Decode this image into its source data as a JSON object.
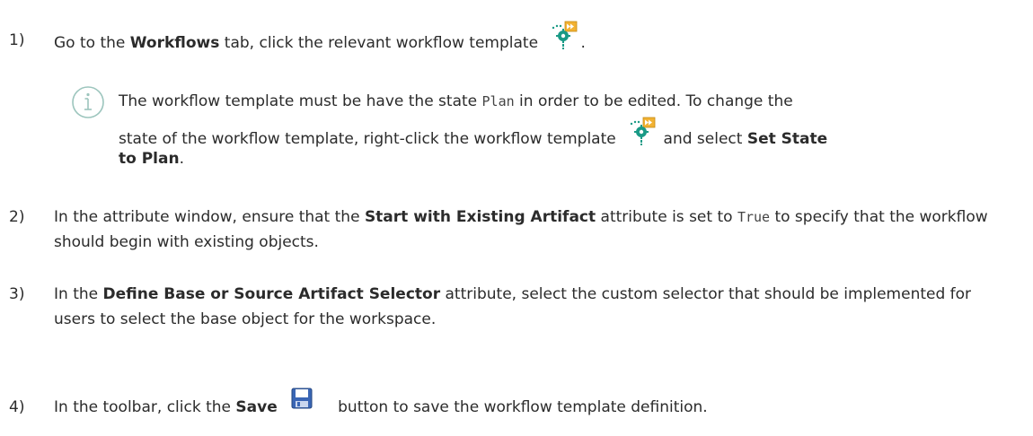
{
  "steps": [
    {
      "number": "1)",
      "pre": "Go to the ",
      "bold1": "Workflows",
      "mid": " tab, click the relevant workflow template",
      "post": ".",
      "icon": "workflow-template-icon"
    },
    {
      "number": "2)",
      "pre": "In the attribute window, ensure that the ",
      "bold1": "Start with Existing Artifact",
      "mid": " attribute is set to ",
      "code": "True",
      "post": " to specify that the workflow should begin with existing objects."
    },
    {
      "number": "3)",
      "pre": "In the ",
      "bold1": "Define Base or Source Artifact Selector",
      "post": " attribute, select the custom selector that should be implemented for users to select the base object for the workspace."
    },
    {
      "number": "4)",
      "pre": "In the toolbar, click the ",
      "bold1": "Save",
      "post": "button to save the workflow template definition.",
      "icon": "save-icon"
    }
  ],
  "note": {
    "icon": "info-icon",
    "pre": "The workflow template must be have the state ",
    "code": "Plan",
    "mid": " in order to be edited. To change the",
    "line2_pre": "state of the workflow template, right-click the workflow template",
    "line2_mid": "and select ",
    "bold1": "Set State",
    "bold2": "to Plan",
    "post": "."
  },
  "colors": {
    "text": "#2b2b2b",
    "info_icon": "#9cc5bd",
    "save_blue": "#3a66b5",
    "gear_teal": "#1a9a86",
    "arrow_orange": "#f2b233"
  }
}
